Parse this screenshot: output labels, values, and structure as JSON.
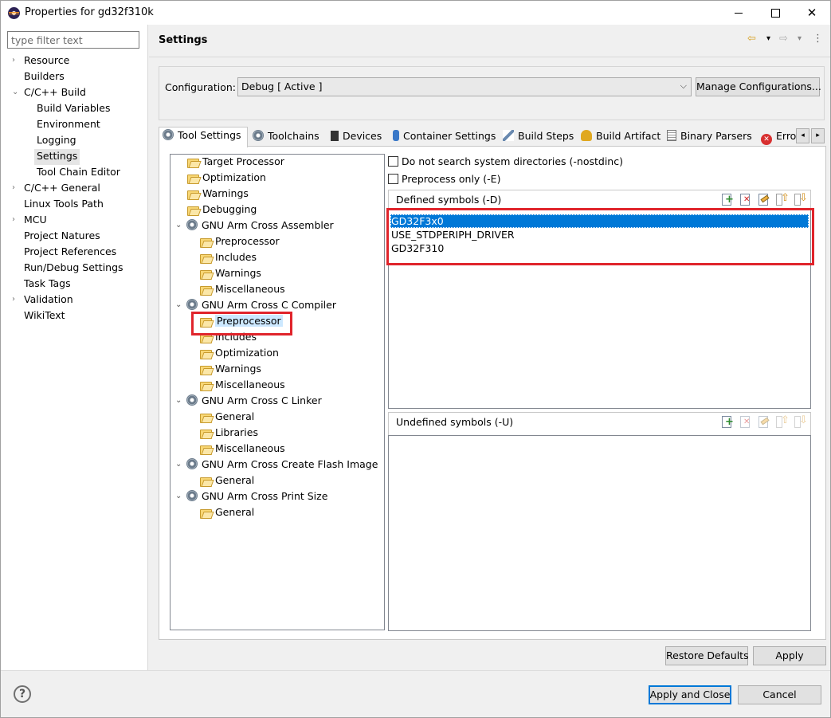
{
  "window": {
    "title": "Properties for gd32f310k",
    "buttons": {
      "minimize": "",
      "maximize": "",
      "close": "✕"
    }
  },
  "filter": {
    "placeholder": "type filter text",
    "value": ""
  },
  "left_tree": [
    {
      "label": "Resource",
      "chevron": "›"
    },
    {
      "label": "Builders",
      "chevron": ""
    },
    {
      "label": "C/C++ Build",
      "chevron": "⌄"
    },
    {
      "label": "Build Variables",
      "chevron": ""
    },
    {
      "label": "Environment",
      "chevron": ""
    },
    {
      "label": "Logging",
      "chevron": ""
    },
    {
      "label": "Settings",
      "chevron": ""
    },
    {
      "label": "Tool Chain Editor",
      "chevron": ""
    },
    {
      "label": "C/C++ General",
      "chevron": "›"
    },
    {
      "label": "Linux Tools Path",
      "chevron": ""
    },
    {
      "label": "MCU",
      "chevron": "›"
    },
    {
      "label": "Project Natures",
      "chevron": ""
    },
    {
      "label": "Project References",
      "chevron": ""
    },
    {
      "label": "Run/Debug Settings",
      "chevron": ""
    },
    {
      "label": "Task Tags",
      "chevron": ""
    },
    {
      "label": "Validation",
      "chevron": "›"
    },
    {
      "label": "WikiText",
      "chevron": ""
    }
  ],
  "page_heading": "Settings",
  "nav": {
    "back": "⇦",
    "back_menu": "▾",
    "forward": "⇨",
    "forward_menu": "▾",
    "more": "⋮"
  },
  "configuration": {
    "label": "Configuration:",
    "value": "Debug  [ Active ]",
    "manage_button": "Manage Configurations..."
  },
  "tabs": [
    "Tool Settings",
    "Toolchains",
    "Devices",
    "Container Settings",
    "Build Steps",
    "Build Artifact",
    "Binary Parsers",
    "Erro"
  ],
  "tab_scroll": {
    "left": "◂",
    "right": "▸"
  },
  "tool_tree": [
    {
      "label": "Target Processor",
      "icon": "folder-icon",
      "twisty": ""
    },
    {
      "label": "Optimization",
      "icon": "folder-icon",
      "twisty": ""
    },
    {
      "label": "Warnings",
      "icon": "folder-icon",
      "twisty": ""
    },
    {
      "label": "Debugging",
      "icon": "folder-icon",
      "twisty": ""
    },
    {
      "label": "GNU Arm Cross Assembler",
      "icon": "gear-icon",
      "twisty": "⌄"
    },
    {
      "label": "Preprocessor",
      "icon": "folder-icon",
      "twisty": ""
    },
    {
      "label": "Includes",
      "icon": "folder-icon",
      "twisty": ""
    },
    {
      "label": "Warnings",
      "icon": "folder-icon",
      "twisty": ""
    },
    {
      "label": "Miscellaneous",
      "icon": "folder-icon",
      "twisty": ""
    },
    {
      "label": "GNU Arm Cross C Compiler",
      "icon": "gear-icon",
      "twisty": "⌄"
    },
    {
      "label": "Preprocessor",
      "icon": "folder-icon",
      "twisty": ""
    },
    {
      "label": "Includes",
      "icon": "folder-icon",
      "twisty": ""
    },
    {
      "label": "Optimization",
      "icon": "folder-icon",
      "twisty": ""
    },
    {
      "label": "Warnings",
      "icon": "folder-icon",
      "twisty": ""
    },
    {
      "label": "Miscellaneous",
      "icon": "folder-icon",
      "twisty": ""
    },
    {
      "label": "GNU Arm Cross C Linker",
      "icon": "gear-icon",
      "twisty": "⌄"
    },
    {
      "label": "General",
      "icon": "folder-icon",
      "twisty": ""
    },
    {
      "label": "Libraries",
      "icon": "folder-icon",
      "twisty": ""
    },
    {
      "label": "Miscellaneous",
      "icon": "folder-icon",
      "twisty": ""
    },
    {
      "label": "GNU Arm Cross Create Flash Image",
      "icon": "gear-icon",
      "twisty": "⌄"
    },
    {
      "label": "General",
      "icon": "folder-icon",
      "twisty": ""
    },
    {
      "label": "GNU Arm Cross Print Size",
      "icon": "gear-icon",
      "twisty": "⌄"
    },
    {
      "label": "General",
      "icon": "folder-icon",
      "twisty": ""
    }
  ],
  "options": {
    "nostdinc": "Do not search system directories (-nostdinc)",
    "preprocess_only": "Preprocess only (-E)"
  },
  "defined_symbols": {
    "title": "Defined symbols (-D)",
    "items": [
      "GD32F3x0",
      "USE_STDPERIPH_DRIVER",
      "GD32F310"
    ]
  },
  "undefined_symbols": {
    "title": "Undefined symbols (-U)",
    "items": []
  },
  "buttons": {
    "restore_defaults": "Restore Defaults",
    "apply": "Apply",
    "apply_and_close": "Apply and Close",
    "cancel": "Cancel",
    "help": "?"
  },
  "colors": {
    "highlight_box": "#e0242b",
    "selection": "#0078d7"
  }
}
